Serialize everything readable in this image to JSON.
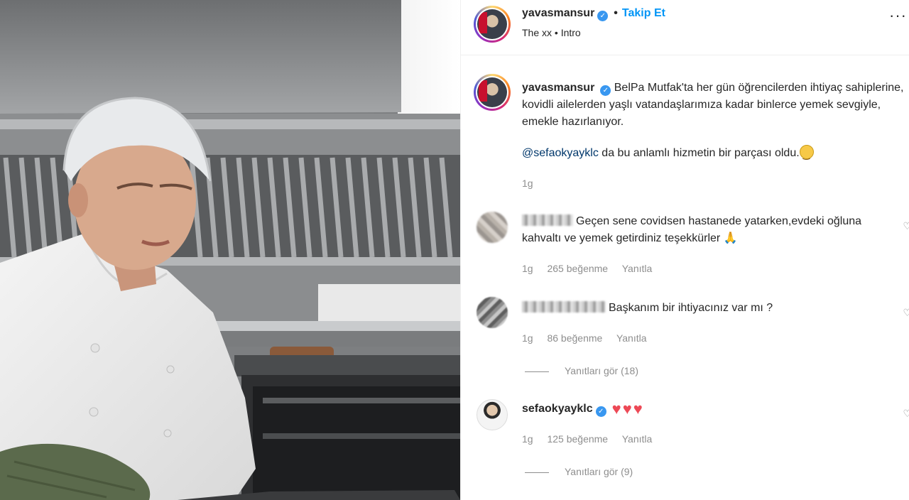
{
  "post": {
    "author": "yavasmansur",
    "follow_label": "Takip Et",
    "separator": "•",
    "audio": "The xx • Intro",
    "more_icon": "more-horizontal-icon",
    "caption": "BelPa Mutfak'ta her gün öğrencilerden ihtiyaç sahiplerine, kovidli ailelerden yaşlı vatandaşlarımıza kadar binlerce yemek sevgiyle, emekle hazırlanıyor.",
    "mention": "@sefaokyayklc",
    "mention_rest": "da bu anlamlı hizmetin bir parçası oldu.",
    "caption_time": "1g"
  },
  "comments": [
    {
      "text": "Geçen sene covidsen hastanede yatarken,evdeki oğluna kahvaltı ve yemek getirdiniz teşekkürler",
      "time": "1g",
      "likes": "265 beğenme",
      "reply": "Yanıtla"
    },
    {
      "text": "Başkanım bir ihtiyacınız var mı ?",
      "time": "1g",
      "likes": "86 beğenme",
      "reply": "Yanıtla",
      "view_replies": "Yanıtları gör (18)"
    },
    {
      "author": "sefaokyayklc",
      "hearts": "♥♥♥",
      "time": "1g",
      "likes": "125 beğenme",
      "reply": "Yanıtla",
      "view_replies": "Yanıtları gör (9)"
    }
  ],
  "colors": {
    "accent": "#0095f6",
    "verified": "#3897f0",
    "muted": "#8e8e8e",
    "heart": "#ed4956"
  }
}
